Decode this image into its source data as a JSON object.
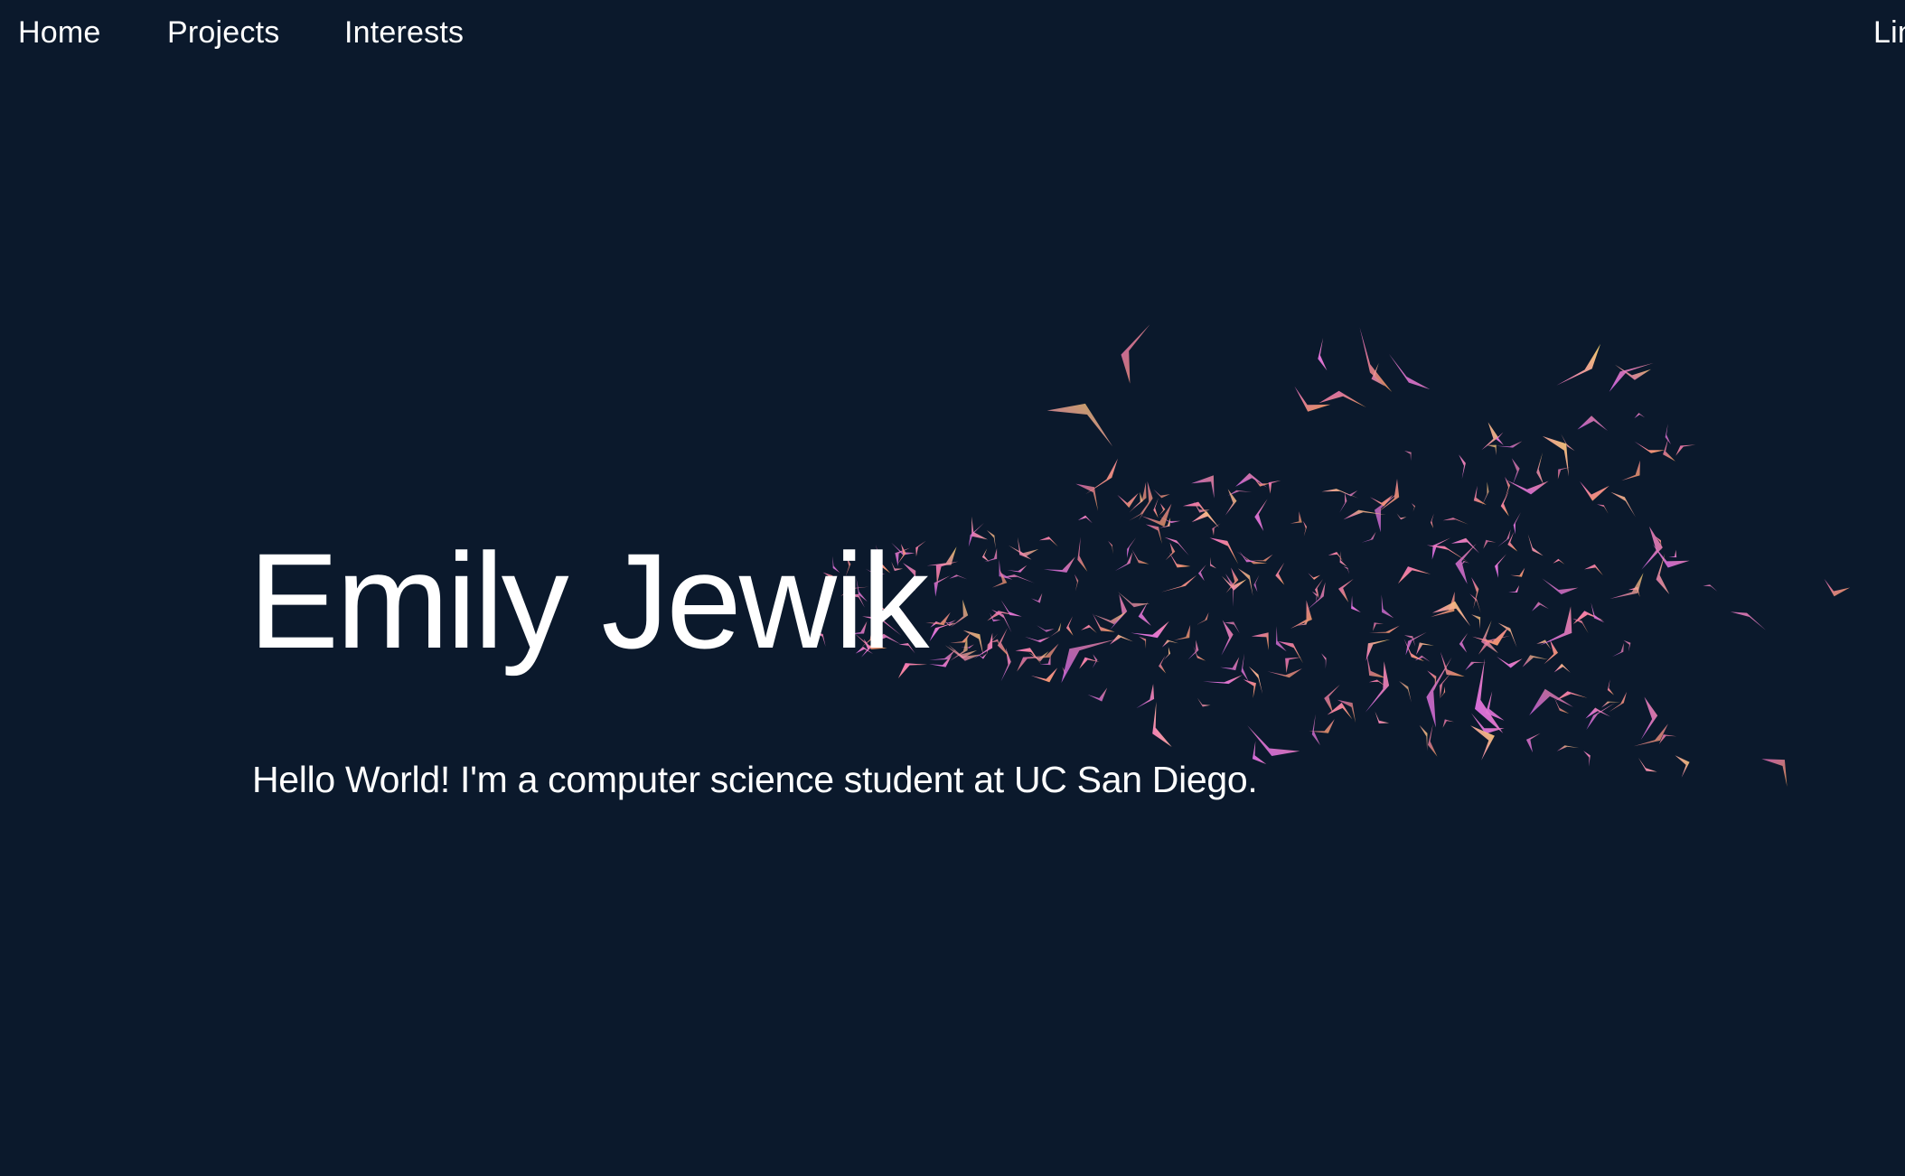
{
  "nav": {
    "items": [
      {
        "label": "Home"
      },
      {
        "label": "Projects"
      },
      {
        "label": "Interests"
      }
    ],
    "right_label": "Lin"
  },
  "hero": {
    "name": "Emily Jewik",
    "tagline": "Hello World! I'm a computer science student at UC San Diego."
  },
  "colors": {
    "background": "#0b192c",
    "text": "#ffffff",
    "flock_pink": "#f06fc8",
    "flock_orange": "#f5a25a",
    "flock_yellow": "#f7d46a",
    "flock_magenta": "#d96af2"
  },
  "decoration": {
    "icon": "paper-bird-flock-icon"
  }
}
